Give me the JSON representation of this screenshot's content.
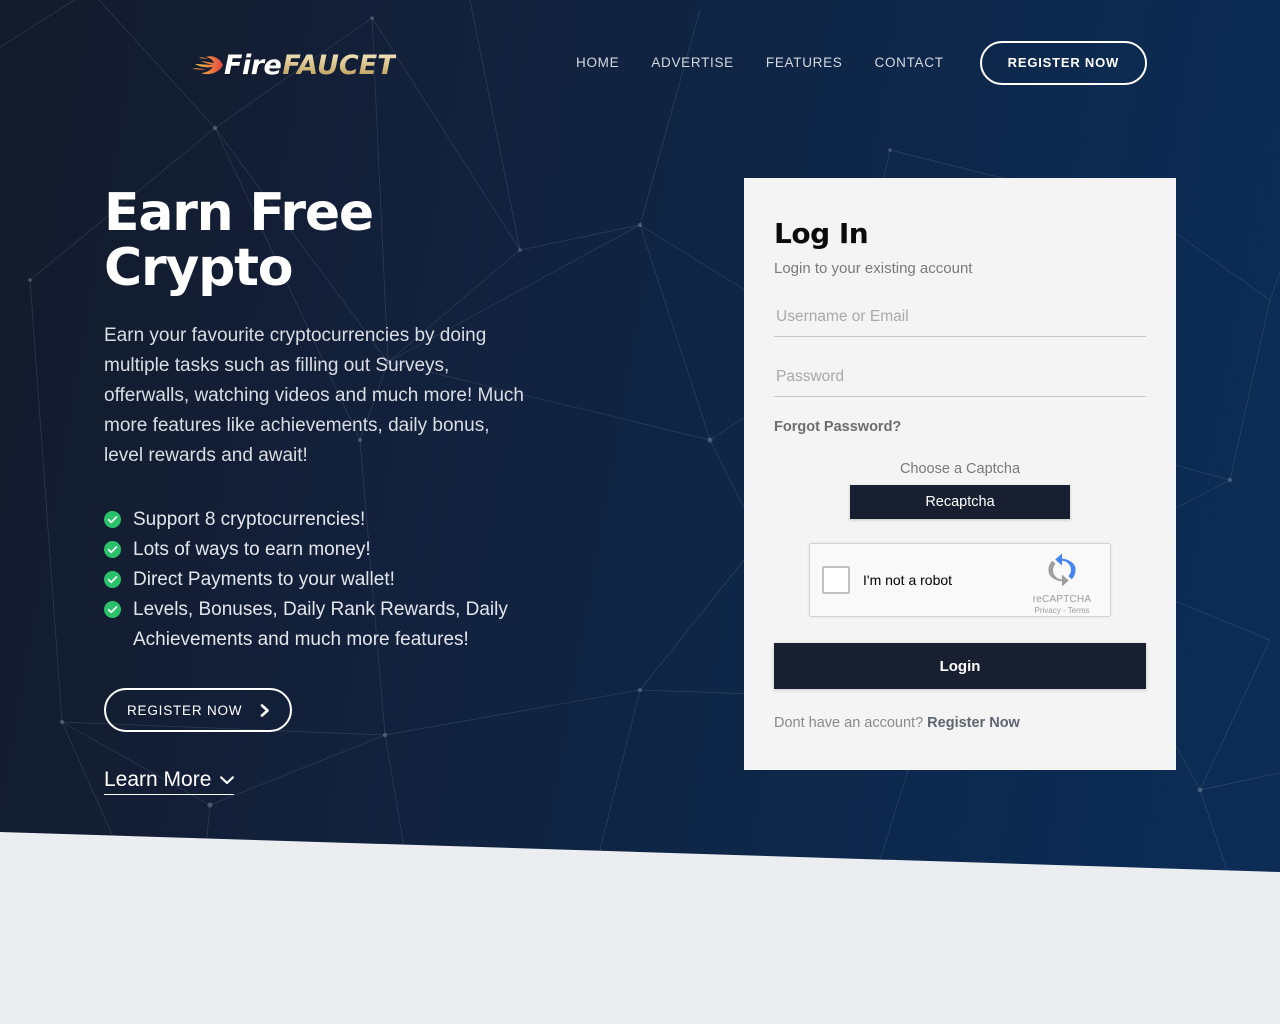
{
  "header": {
    "logo": {
      "icon": "flame-icon",
      "text_primary": "Fire",
      "text_secondary": "FAUCET"
    },
    "nav_items": [
      {
        "label": "HOME"
      },
      {
        "label": "ADVERTISE"
      },
      {
        "label": "FEATURES"
      },
      {
        "label": "CONTACT"
      }
    ],
    "register_button": "REGISTER NOW"
  },
  "hero": {
    "title": "Earn Free Crypto",
    "subtitle": "Earn your favourite cryptocurrencies by doing multiple tasks such as filling out Surveys, offerwalls, watching videos and much more! Much more features like achievements, daily bonus, level rewards and await!",
    "features": [
      {
        "icon": "check-circle-icon",
        "label": "Support 8 cryptocurrencies!"
      },
      {
        "icon": "check-circle-icon",
        "label": "Lots of ways to earn money!"
      },
      {
        "icon": "check-circle-icon",
        "label": "Direct Payments to your wallet!"
      },
      {
        "icon": "check-circle-icon",
        "label": "Levels, Bonuses, Daily Rank Rewards, Daily Achievements and much more features!"
      }
    ],
    "cta_register": "REGISTER NOW",
    "cta_register_icon": "chevron-right-icon",
    "learn_more": "Learn More",
    "learn_more_icon": "chevron-down-icon"
  },
  "login": {
    "title": "Log In",
    "subtitle": "Login to your existing account",
    "username_placeholder": "Username or Email",
    "username_value": "",
    "password_placeholder": "Password",
    "password_value": "",
    "forgot_password": "Forgot Password?",
    "captcha_label": "Choose a Captcha",
    "captcha_option": "Recaptcha",
    "recaptcha": {
      "checkbox_label": "I'm not a robot",
      "brand": "reCAPTCHA",
      "privacy": "Privacy",
      "separator": "-",
      "terms": "Terms"
    },
    "login_button": "Login",
    "signup_prompt": "Dont have an account?",
    "signup_link": "Register Now"
  },
  "colors": {
    "hero_dark": "#131b2a",
    "hero_navy": "#0c2b53",
    "card_bg": "#f4f4f4",
    "button_dark": "#171f31",
    "check_green": "#2bc06a",
    "page_bg": "#ebedf0",
    "logo_gold": "#dcc48c"
  }
}
